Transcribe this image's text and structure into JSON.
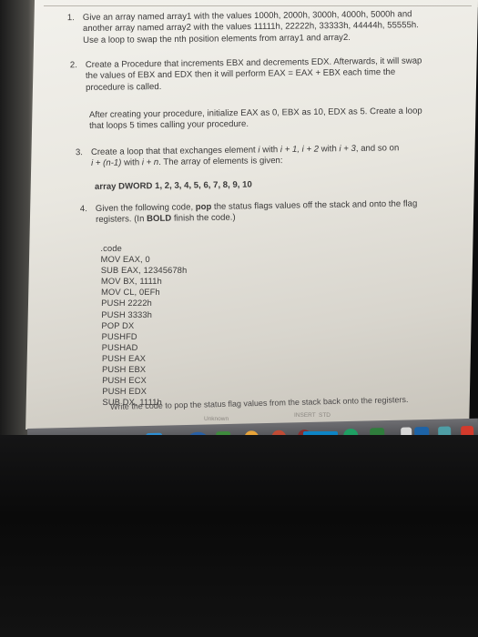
{
  "questions": [
    {
      "number": "1.",
      "lines": [
        "Give an array named array1 with the values 1000h, 2000h, 3000h, 4000h, 5000h and",
        "another array named array2 with the values 11111h, 22222h, 33333h, 44444h, 55555h.",
        "Use a loop to swap the nth position elements from array1 and array2."
      ]
    },
    {
      "number": "2.",
      "lines": [
        "Create a Procedure that increments EBX and decrements EDX. Afterwards, it will swap",
        "the values of EBX and EDX then it will perform EAX = EAX + EBX each time the",
        "procedure is called."
      ],
      "followup": [
        "After creating your procedure, initialize EAX as 0, EBX as 10, EDX as 5. Create a loop",
        "that loops 5 times calling your procedure."
      ]
    },
    {
      "number": "3.",
      "line1_a": "Create a loop that that exchanges element ",
      "line1_i": "i",
      "line1_b": " with ",
      "line1_c": "i + 1, i + 2",
      "line1_d": " with ",
      "line1_e": "i + 3",
      "line1_f": ", and so on",
      "line2_a": "i + (n-1)",
      "line2_b": " with ",
      "line2_c": "i + n",
      "line2_d": ". The array of elements is given:",
      "array_line": "array DWORD 1, 2, 3, 4, 5, 6, 7, 8, 9, 10"
    },
    {
      "number": "4.",
      "line1_a": "Given the following code, ",
      "line1_bold": "pop",
      "line1_b": " the status flags values off the stack and onto the flag",
      "line2_a": "registers. (In ",
      "line2_bold": "BOLD",
      "line2_b": " finish the code.)"
    }
  ],
  "code_lines": [
    ".code",
    "MOV EAX, 0",
    "SUB EAX, 12345678h",
    "MOV BX, 1111h",
    "MOV CL, 0EFh",
    "PUSH 2222h",
    "PUSH 3333h",
    "POP DX",
    "PUSHFD",
    "PUSHAD",
    "PUSH EAX",
    "PUSH EBX",
    "PUSH ECX",
    "PUSH EDX",
    "SUB DX, 1111h"
  ],
  "write_line": "Write the code to pop the status flag values from the stack back onto the registers.",
  "status_bar": {
    "left": "Unknown",
    "mode1": "INSERT",
    "mode2": "STD"
  },
  "taskbar": {
    "s_badge": "S28"
  },
  "colors": {
    "screen": "#ecebe5",
    "text": "#3b3a3a",
    "taskbar": "#55565a",
    "badge": "#0e84c5"
  }
}
